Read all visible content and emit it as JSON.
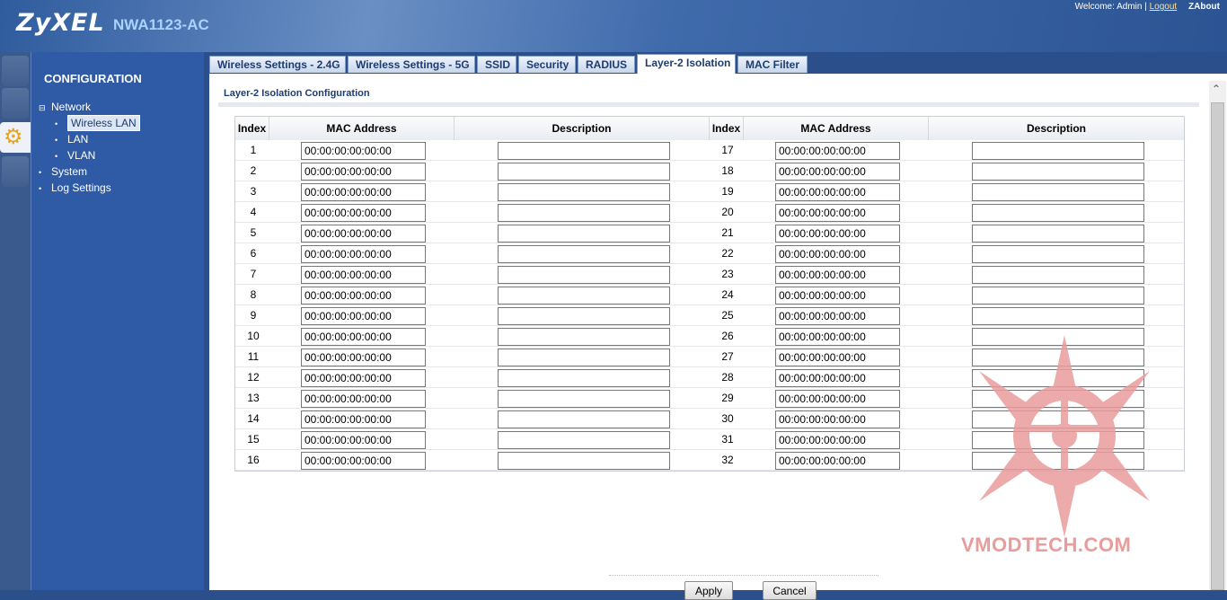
{
  "header": {
    "brand": "ZyXEL",
    "model": "NWA1123-AC",
    "welcome": "Welcome: Admin",
    "separator": "|",
    "logout": "Logout",
    "about": "About"
  },
  "sidebar": {
    "title": "CONFIGURATION",
    "items": [
      {
        "label": "Network",
        "marker": "⊟"
      },
      {
        "label": "Wireless LAN",
        "marker": "•"
      },
      {
        "label": "LAN",
        "marker": "•"
      },
      {
        "label": "VLAN",
        "marker": "•"
      },
      {
        "label": "System",
        "marker": "•"
      },
      {
        "label": "Log Settings",
        "marker": "•"
      }
    ]
  },
  "tabs": [
    "Wireless Settings - 2.4G",
    "Wireless Settings - 5G",
    "SSID",
    "Security",
    "RADIUS",
    "Layer-2 Isolation",
    "MAC Filter"
  ],
  "active_tab": "Layer-2 Isolation",
  "panel": {
    "title": "Layer-2 Isolation Configuration",
    "columns": [
      "Index",
      "MAC Address",
      "Description"
    ],
    "default_mac": "00:00:00:00:00:00",
    "left_indices": [
      "1",
      "2",
      "3",
      "4",
      "5",
      "6",
      "7",
      "8",
      "9",
      "10",
      "11",
      "12",
      "13",
      "14",
      "15",
      "16"
    ],
    "right_indices": [
      "17",
      "18",
      "19",
      "20",
      "21",
      "22",
      "23",
      "24",
      "25",
      "26",
      "27",
      "28",
      "29",
      "30",
      "31",
      "32"
    ]
  },
  "buttons": {
    "apply": "Apply",
    "cancel": "Cancel"
  },
  "watermark": "VMODTECH.COM",
  "colors": {
    "brand_blue": "#2f5aa5",
    "header_text": "#1f3c6e",
    "watermark": "#e99c9c"
  }
}
